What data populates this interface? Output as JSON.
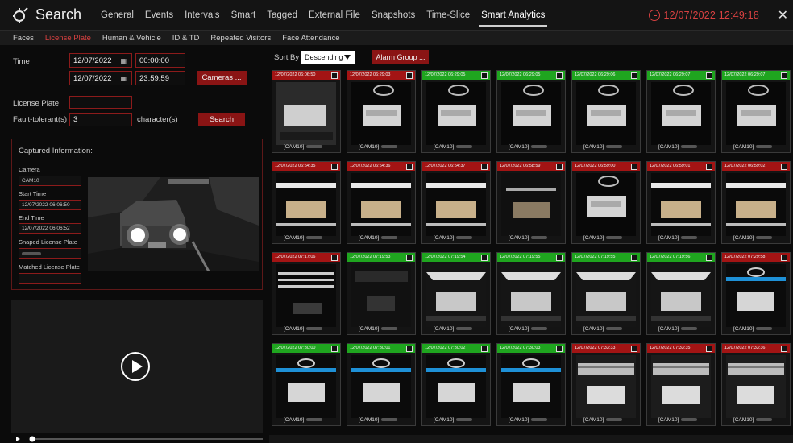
{
  "header": {
    "title": "Search",
    "clock": "12/07/2022 12:49:18",
    "tabs": [
      "General",
      "Events",
      "Intervals",
      "Smart",
      "Tagged",
      "External File",
      "Snapshots",
      "Time-Slice",
      "Smart Analytics"
    ],
    "active_tab": "Smart Analytics"
  },
  "subtabs": {
    "items": [
      "Faces",
      "License Plate",
      "Human & Vehicle",
      "ID & TD",
      "Repeated Visitors",
      "Face Attendance"
    ],
    "active": "License Plate"
  },
  "filters": {
    "time_label": "Time",
    "start_date": "12/07/2022",
    "start_time": "00:00:00",
    "end_date": "12/07/2022",
    "end_time": "23:59:59",
    "cameras_button": "Cameras ...",
    "plate_label": "License Plate",
    "plate_value": "",
    "fault_label": "Fault-tolerant(s)",
    "fault_value": "3",
    "fault_unit": "character(s)",
    "search_button": "Search"
  },
  "captured": {
    "title": "Captured Information:",
    "camera_label": "Camera",
    "camera_value": "CAM10",
    "start_label": "Start Time",
    "start_value": "12/07/2022 06:06:50",
    "end_label": "End Time",
    "end_value": "12/07/2022 06:06:52",
    "snaped_label": "Snaped License Plate",
    "matched_label": "Matched License Plate"
  },
  "sort": {
    "label": "Sort By",
    "value": "Descending",
    "alarm_button": "Alarm Group ..."
  },
  "results": [
    {
      "time": "12/07/2022 06:06:50",
      "status": "red",
      "cam": "[CAM10]"
    },
    {
      "time": "12/07/2022 06:29:03",
      "status": "red",
      "cam": "[CAM10]"
    },
    {
      "time": "12/07/2022 06:29:05",
      "status": "green",
      "cam": "[CAM10]"
    },
    {
      "time": "12/07/2022 06:29:05",
      "status": "green",
      "cam": "[CAM10]"
    },
    {
      "time": "12/07/2022 06:29:06",
      "status": "green",
      "cam": "[CAM10]"
    },
    {
      "time": "12/07/2022 06:29:07",
      "status": "green",
      "cam": "[CAM10]"
    },
    {
      "time": "12/07/2022 06:29:07",
      "status": "green",
      "cam": "[CAM10]"
    },
    {
      "time": "12/07/2022 06:54:35",
      "status": "red",
      "cam": "[CAM10]"
    },
    {
      "time": "12/07/2022 06:54:36",
      "status": "red",
      "cam": "[CAM10]"
    },
    {
      "time": "12/07/2022 06:54:37",
      "status": "red",
      "cam": "[CAM10]"
    },
    {
      "time": "12/07/2022 06:58:59",
      "status": "red",
      "cam": "[CAM10]"
    },
    {
      "time": "12/07/2022 06:59:00",
      "status": "red",
      "cam": "[CAM10]"
    },
    {
      "time": "12/07/2022 06:59:01",
      "status": "red",
      "cam": "[CAM10]"
    },
    {
      "time": "12/07/2022 06:59:02",
      "status": "red",
      "cam": "[CAM10]"
    },
    {
      "time": "12/07/2022 07:17:06",
      "status": "red",
      "cam": "[CAM10]"
    },
    {
      "time": "12/07/2022 07:19:53",
      "status": "green",
      "cam": "[CAM10]"
    },
    {
      "time": "12/07/2022 07:19:54",
      "status": "green",
      "cam": "[CAM10]"
    },
    {
      "time": "12/07/2022 07:19:55",
      "status": "green",
      "cam": "[CAM10]"
    },
    {
      "time": "12/07/2022 07:19:55",
      "status": "green",
      "cam": "[CAM10]"
    },
    {
      "time": "12/07/2022 07:19:56",
      "status": "green",
      "cam": "[CAM10]"
    },
    {
      "time": "12/07/2022 07:29:58",
      "status": "red",
      "cam": "[CAM10]"
    },
    {
      "time": "12/07/2022 07:30:00",
      "status": "green",
      "cam": "[CAM10]"
    },
    {
      "time": "12/07/2022 07:30:01",
      "status": "green",
      "cam": "[CAM10]"
    },
    {
      "time": "12/07/2022 07:30:02",
      "status": "green",
      "cam": "[CAM10]"
    },
    {
      "time": "12/07/2022 07:30:03",
      "status": "green",
      "cam": "[CAM10]"
    },
    {
      "time": "12/07/2022 07:33:33",
      "status": "red",
      "cam": "[CAM10]"
    },
    {
      "time": "12/07/2022 07:33:35",
      "status": "red",
      "cam": "[CAM10]"
    },
    {
      "time": "12/07/2022 07:33:36",
      "status": "red",
      "cam": "[CAM10]"
    }
  ],
  "colors": {
    "accent_red": "#a31414",
    "match_green": "#1fa51f",
    "clock_red": "#d84141"
  }
}
